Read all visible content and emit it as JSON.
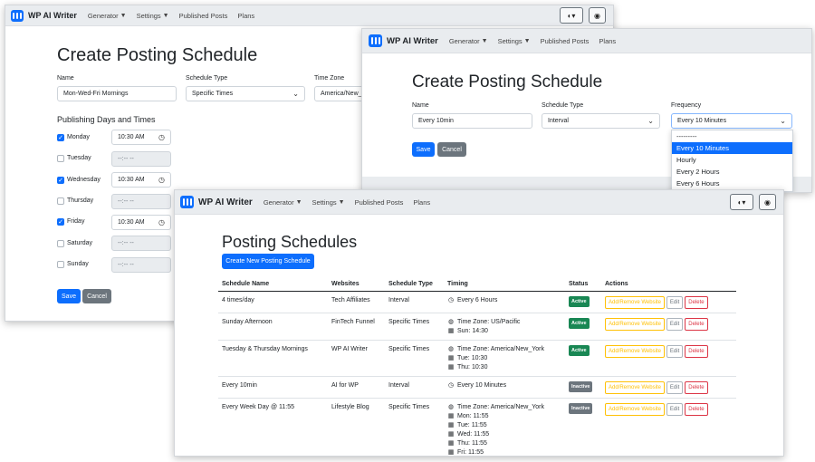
{
  "nav": {
    "brand": "WP AI Writer",
    "items": [
      "Generator",
      "Settings",
      "Published Posts",
      "Plans"
    ]
  },
  "win1": {
    "title": "Create Posting Schedule",
    "name_label": "Name",
    "name_value": "Mon-Wed-Fri Mornings",
    "type_label": "Schedule Type",
    "type_value": "Specific Times",
    "tz_label": "Time Zone",
    "tz_value": "America/New_Y",
    "days_heading": "Publishing Days and Times",
    "days": [
      {
        "day": "Monday",
        "checked": true,
        "time": "10:30 AM"
      },
      {
        "day": "Tuesday",
        "checked": false,
        "time": "--:-- --"
      },
      {
        "day": "Wednesday",
        "checked": true,
        "time": "10:30 AM"
      },
      {
        "day": "Thursday",
        "checked": false,
        "time": "--:-- --"
      },
      {
        "day": "Friday",
        "checked": true,
        "time": "10:30 AM"
      },
      {
        "day": "Saturday",
        "checked": false,
        "time": "--:-- --"
      },
      {
        "day": "Sunday",
        "checked": false,
        "time": "--:-- --"
      }
    ],
    "save": "Save",
    "cancel": "Cancel"
  },
  "win2": {
    "title": "Create Posting Schedule",
    "name_label": "Name",
    "name_value": "Every 10min",
    "type_label": "Schedule Type",
    "type_value": "Interval",
    "freq_label": "Frequency",
    "freq_value": "Every 10 Minutes",
    "options": [
      "---------",
      "Every 10 Minutes",
      "Hourly",
      "Every 2 Hours",
      "Every 6 Hours"
    ],
    "selected_option": 1,
    "save": "Save",
    "cancel": "Cancel"
  },
  "win3": {
    "title": "Posting Schedules",
    "create_button": "Create New Posting Schedule",
    "headers": [
      "Schedule Name",
      "Websites",
      "Schedule Type",
      "Timing",
      "Status",
      "Actions"
    ],
    "actions": {
      "add_remove": "Add/Remove Website",
      "edit": "Edit",
      "delete": "Delete"
    },
    "rows": [
      {
        "name": "4 times/day",
        "website": "Tech Affiliates",
        "type": "Interval",
        "timing": [
          {
            "icon": "clock",
            "text": "Every 6 Hours"
          }
        ],
        "status": "Active"
      },
      {
        "name": "Sunday Afternoon",
        "website": "FinTech Funnel",
        "type": "Specific Times",
        "timing": [
          {
            "icon": "globe",
            "text": "Time Zone: US/Pacific"
          },
          {
            "icon": "calendar",
            "text": "Sun: 14:30"
          }
        ],
        "status": "Active"
      },
      {
        "name": "Tuesday & Thursday Mornings",
        "website": "WP AI Writer",
        "type": "Specific Times",
        "timing": [
          {
            "icon": "globe",
            "text": "Time Zone: America/New_York"
          },
          {
            "icon": "calendar",
            "text": "Tue: 10:30"
          },
          {
            "icon": "calendar",
            "text": "Thu: 10:30"
          }
        ],
        "status": "Active"
      },
      {
        "name": "Every 10min",
        "website": "AI for WP",
        "type": "Interval",
        "timing": [
          {
            "icon": "clock",
            "text": "Every 10 Minutes"
          }
        ],
        "status": "Inactive"
      },
      {
        "name": "Every Week Day @ 11:55",
        "website": "Lifestyle Blog",
        "type": "Specific Times",
        "timing": [
          {
            "icon": "globe",
            "text": "Time Zone: America/New_York"
          },
          {
            "icon": "calendar",
            "text": "Mon: 11:55"
          },
          {
            "icon": "calendar",
            "text": "Tue: 11:55"
          },
          {
            "icon": "calendar",
            "text": "Wed: 11:55"
          },
          {
            "icon": "calendar",
            "text": "Thu: 11:55"
          },
          {
            "icon": "calendar",
            "text": "Fri: 11:55"
          }
        ],
        "status": "Inactive"
      }
    ]
  },
  "colors": {
    "primary": "#0d6efd",
    "secondary": "#6c757d",
    "success": "#198754",
    "navbar": "#e9ecef"
  }
}
